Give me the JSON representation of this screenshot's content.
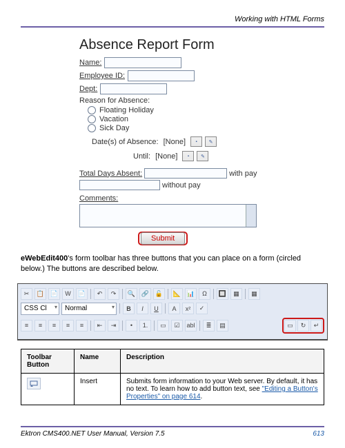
{
  "header": {
    "section_title": "Working with HTML Forms"
  },
  "form": {
    "title": "Absence Report Form",
    "name_label": "Name:",
    "empid_label": "Employee ID:",
    "dept_label": "Dept:",
    "reason_label": "Reason for Absence:",
    "radios": [
      "Floating Holiday",
      "Vacation",
      "Sick Day"
    ],
    "dates_label": "Date(s) of Absence:",
    "until_label": "Until:",
    "none_text": "[None]",
    "total_label": "Total Days Absent:",
    "with_pay": "with pay",
    "without_pay": "without pay",
    "comments_label": "Comments:",
    "submit_label": "Submit"
  },
  "body": {
    "product": "eWebEdit400",
    "text1": "'s form toolbar has three buttons that you can place on a form (circled below.) The buttons are described below."
  },
  "toolbar": {
    "dropdown1": "CSS Cl",
    "dropdown2": "Normal"
  },
  "table": {
    "headers": [
      "Toolbar Button",
      "Name",
      "Description"
    ],
    "row1": {
      "name": "Insert",
      "desc": "Submits form information to your Web server. By default, it has no text. To learn how to add button text, see ",
      "link": "\"Editing a Button's Properties\" on page 614",
      "period": "."
    }
  },
  "footer": {
    "left": "Ektron CMS400.NET User Manual, Version 7.5",
    "page": "613"
  }
}
